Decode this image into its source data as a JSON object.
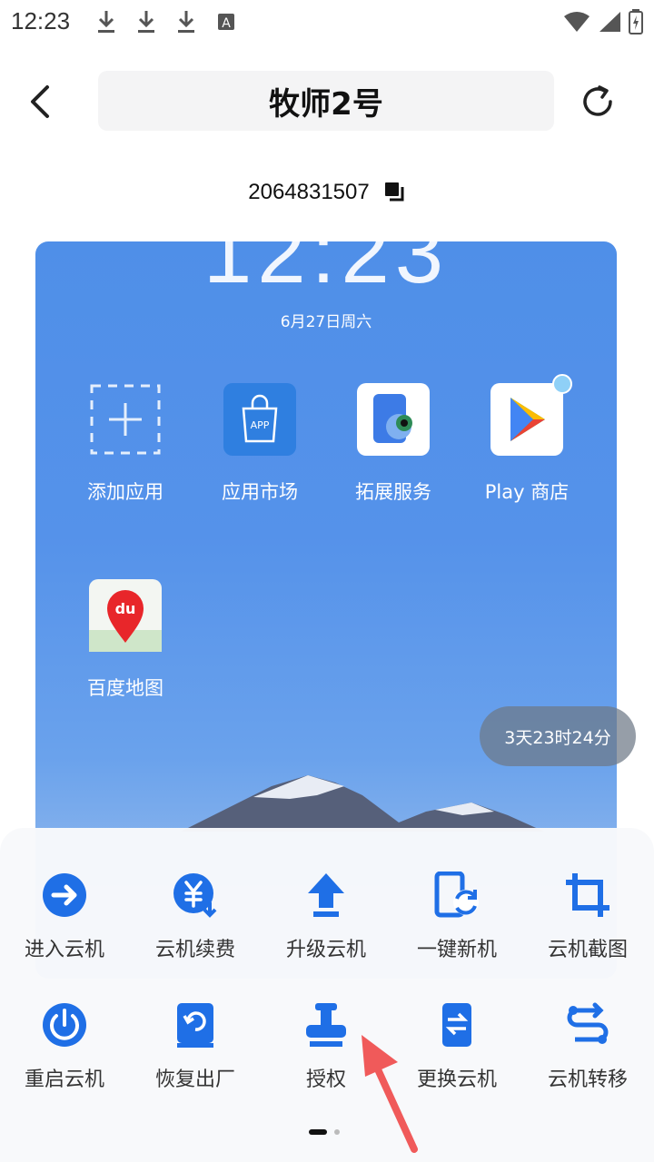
{
  "status": {
    "time": "12:23"
  },
  "header": {
    "title": "牧师2号"
  },
  "device": {
    "id": "2064831507"
  },
  "screen": {
    "date": "6月27日周六",
    "clock": "12:23",
    "apps": [
      {
        "label": "添加应用",
        "icon": "add-app-icon"
      },
      {
        "label": "应用市场",
        "icon": "app-market-icon",
        "badge": "APP"
      },
      {
        "label": "拓展服务",
        "icon": "extension-service-icon"
      },
      {
        "label": "Play 商店",
        "icon": "play-store-icon"
      },
      {
        "label": "百度地图",
        "icon": "baidu-map-icon",
        "badge": "du"
      }
    ],
    "countdown": "3天23时24分"
  },
  "actions": {
    "row1": [
      {
        "label": "进入云机",
        "icon": "enter-arrow-icon"
      },
      {
        "label": "云机续费",
        "icon": "renew-yen-icon"
      },
      {
        "label": "升级云机",
        "icon": "upgrade-icon"
      },
      {
        "label": "一键新机",
        "icon": "new-device-icon"
      },
      {
        "label": "云机截图",
        "icon": "crop-icon"
      }
    ],
    "row2": [
      {
        "label": "重启云机",
        "icon": "power-icon"
      },
      {
        "label": "恢复出厂",
        "icon": "factory-reset-icon"
      },
      {
        "label": "授权",
        "icon": "stamp-icon"
      },
      {
        "label": "更换云机",
        "icon": "replace-device-icon"
      },
      {
        "label": "云机转移",
        "icon": "transfer-icon"
      }
    ]
  },
  "colors": {
    "accent": "#1f6fe6",
    "annotation_arrow": "#f05a5a"
  }
}
